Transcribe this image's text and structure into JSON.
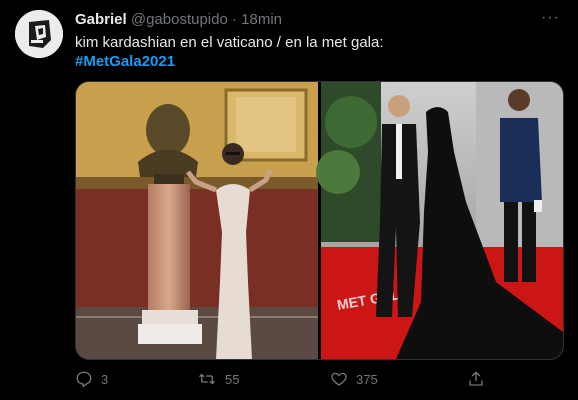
{
  "tweet": {
    "display_name": "Gabriel",
    "handle": "@gabostupido",
    "separator": "·",
    "time": "18min",
    "text": "kim kardashian en el vaticano / en la met gala:",
    "hashtag": "#MetGala2021",
    "more": "···"
  },
  "actions": {
    "reply_count": "3",
    "retweet_count": "55",
    "like_count": "375"
  },
  "media": {
    "left_photo": "vatican-photo",
    "right_photo": "met-gala-photo",
    "right_photo_carpet_text": "MET GALA"
  },
  "colors": {
    "background": "#000000",
    "text": "#e7e9ea",
    "secondary": "#71767b",
    "link": "#1d9bf0",
    "red_carpet": "#cc1616"
  }
}
